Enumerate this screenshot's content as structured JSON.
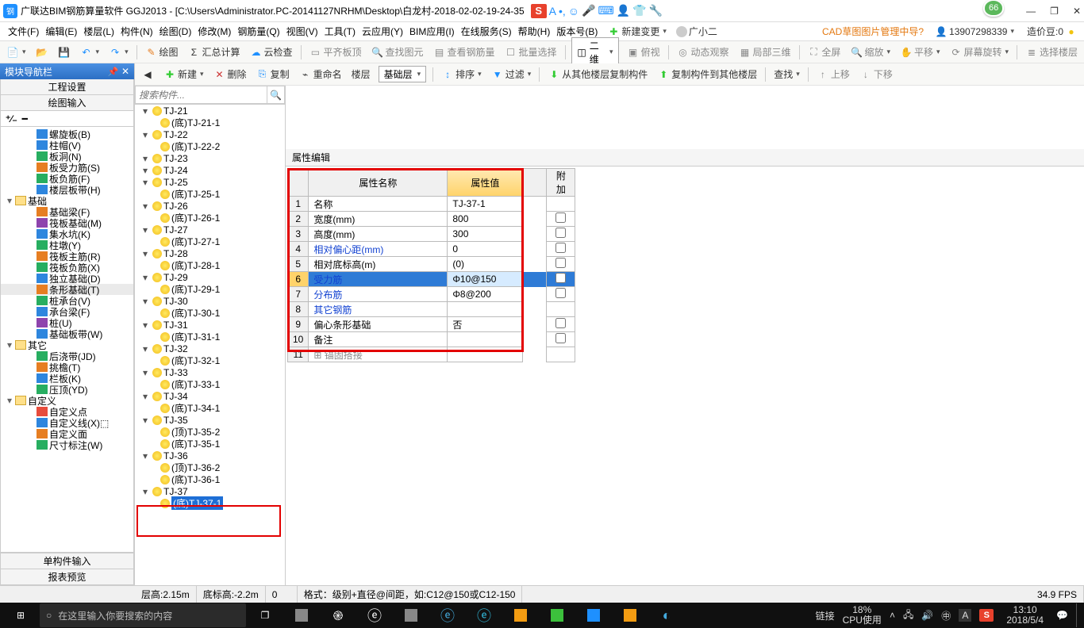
{
  "title": "广联达BIM钢筋算量软件 GGJ2013 - [C:\\Users\\Administrator.PC-20141127NRHM\\Desktop\\白龙村-2018-02-02-19-24-35",
  "ime_letter": "S",
  "badge": "66",
  "window_buttons": {
    "min": "—",
    "max": "❐",
    "close": "✕"
  },
  "menus": [
    "文件(F)",
    "编辑(E)",
    "楼层(L)",
    "构件(N)",
    "绘图(D)",
    "修改(M)",
    "钢筋量(Q)",
    "视图(V)",
    "工具(T)",
    "云应用(Y)",
    "BIM应用(I)",
    "在线服务(S)",
    "帮助(H)",
    "版本号(B)"
  ],
  "menu_extra": {
    "new_change": "新建变更",
    "user": "广小二",
    "cad_link": "CAD草图图片管理中导?",
    "phone": "13907298339",
    "price": "造价豆:0"
  },
  "tb1": {
    "draw": "绘图",
    "sum": "汇总计算",
    "cloud": "云检查",
    "flat": "平齐板顶",
    "find": "查找图元",
    "view_steel": "查看钢筋量",
    "batch": "批量选择",
    "dim": "二维",
    "over": "俯视",
    "anim": "动态观察",
    "local3d": "局部三维",
    "full": "全屏",
    "zoom": "缩放",
    "pan": "平移",
    "rot": "屏幕旋转",
    "sel_floor": "选择楼层"
  },
  "tb2": {
    "new": "新建",
    "del": "删除",
    "copy": "复制",
    "rename": "重命名",
    "floor": "楼层",
    "basic": "基础层",
    "sort": "排序",
    "filter": "过滤",
    "copy_from": "从其他楼层复制构件",
    "copy_to": "复制构件到其他楼层",
    "search": "查找",
    "up": "上移",
    "down": "下移"
  },
  "left": {
    "title": "模块导航栏",
    "s1": "工程设置",
    "s2": "绘图输入",
    "single": "单构件输入",
    "report": "报表预览",
    "tree": [
      {
        "d": 3,
        "ic": "#2e86de",
        "t": "螺旋板(B)"
      },
      {
        "d": 3,
        "ic": "#2e86de",
        "t": "柱帽(V)"
      },
      {
        "d": 3,
        "ic": "#27ae60",
        "t": "板洞(N)"
      },
      {
        "d": 3,
        "ic": "#e67e22",
        "t": "板受力筋(S)"
      },
      {
        "d": 3,
        "ic": "#27ae60",
        "t": "板负筋(F)"
      },
      {
        "d": 3,
        "ic": "#2e86de",
        "t": "楼层板带(H)"
      },
      {
        "d": 1,
        "exp": "▾",
        "fold": true,
        "t": "基础"
      },
      {
        "d": 3,
        "ic": "#e67e22",
        "t": "基础梁(F)"
      },
      {
        "d": 3,
        "ic": "#8e44ad",
        "t": "筏板基础(M)"
      },
      {
        "d": 3,
        "ic": "#2e86de",
        "t": "集水坑(K)"
      },
      {
        "d": 3,
        "ic": "#27ae60",
        "t": "柱墩(Y)"
      },
      {
        "d": 3,
        "ic": "#e67e22",
        "t": "筏板主筋(R)"
      },
      {
        "d": 3,
        "ic": "#27ae60",
        "t": "筏板负筋(X)"
      },
      {
        "d": 3,
        "ic": "#2e86de",
        "t": "独立基础(D)"
      },
      {
        "d": 3,
        "ic": "#e67e22",
        "t": "条形基础(T)",
        "sel": true
      },
      {
        "d": 3,
        "ic": "#27ae60",
        "t": "桩承台(V)"
      },
      {
        "d": 3,
        "ic": "#2e86de",
        "t": "承台梁(F)"
      },
      {
        "d": 3,
        "ic": "#8e44ad",
        "t": "桩(U)"
      },
      {
        "d": 3,
        "ic": "#2e86de",
        "t": "基础板带(W)"
      },
      {
        "d": 1,
        "exp": "▾",
        "fold": true,
        "t": "其它"
      },
      {
        "d": 3,
        "ic": "#27ae60",
        "t": "后浇带(JD)"
      },
      {
        "d": 3,
        "ic": "#e67e22",
        "t": "挑檐(T)"
      },
      {
        "d": 3,
        "ic": "#2e86de",
        "t": "栏板(K)"
      },
      {
        "d": 3,
        "ic": "#27ae60",
        "t": "压顶(YD)"
      },
      {
        "d": 1,
        "exp": "▾",
        "fold": true,
        "t": "自定义"
      },
      {
        "d": 3,
        "ic": "#e74c3c",
        "t": "自定义点"
      },
      {
        "d": 3,
        "ic": "#2e86de",
        "t": "自定义线(X)⬚"
      },
      {
        "d": 3,
        "ic": "#e67e22",
        "t": "自定义面"
      },
      {
        "d": 3,
        "ic": "#27ae60",
        "t": "尺寸标注(W)"
      }
    ]
  },
  "mid": {
    "search_ph": "搜索构件...",
    "tree": [
      {
        "p": 1,
        "t": "TJ-21"
      },
      {
        "p": 0,
        "t": "(底)TJ-21-1"
      },
      {
        "p": 1,
        "t": "TJ-22"
      },
      {
        "p": 0,
        "t": "(底)TJ-22-2"
      },
      {
        "p": 1,
        "t": "TJ-23"
      },
      {
        "p": 1,
        "t": "TJ-24"
      },
      {
        "p": 1,
        "t": "TJ-25"
      },
      {
        "p": 0,
        "t": "(底)TJ-25-1"
      },
      {
        "p": 1,
        "t": "TJ-26"
      },
      {
        "p": 0,
        "t": "(底)TJ-26-1"
      },
      {
        "p": 1,
        "t": "TJ-27"
      },
      {
        "p": 0,
        "t": "(底)TJ-27-1"
      },
      {
        "p": 1,
        "t": "TJ-28"
      },
      {
        "p": 0,
        "t": "(底)TJ-28-1"
      },
      {
        "p": 1,
        "t": "TJ-29"
      },
      {
        "p": 0,
        "t": "(底)TJ-29-1"
      },
      {
        "p": 1,
        "t": "TJ-30"
      },
      {
        "p": 0,
        "t": "(底)TJ-30-1"
      },
      {
        "p": 1,
        "t": "TJ-31"
      },
      {
        "p": 0,
        "t": "(底)TJ-31-1"
      },
      {
        "p": 1,
        "t": "TJ-32"
      },
      {
        "p": 0,
        "t": "(底)TJ-32-1"
      },
      {
        "p": 1,
        "t": "TJ-33"
      },
      {
        "p": 0,
        "t": "(底)TJ-33-1"
      },
      {
        "p": 1,
        "t": "TJ-34"
      },
      {
        "p": 0,
        "t": "(底)TJ-34-1"
      },
      {
        "p": 1,
        "t": "TJ-35"
      },
      {
        "p": 0,
        "t": "(顶)TJ-35-2"
      },
      {
        "p": 0,
        "t": "(底)TJ-35-1"
      },
      {
        "p": 1,
        "t": "TJ-36"
      },
      {
        "p": 0,
        "t": "(顶)TJ-36-2"
      },
      {
        "p": 0,
        "t": "(底)TJ-36-1"
      },
      {
        "p": 1,
        "t": "TJ-37"
      },
      {
        "p": 0,
        "t": "(底)TJ-37-1",
        "sel": true
      }
    ]
  },
  "prop": {
    "title": "属性编辑",
    "head": {
      "name": "属性名称",
      "val": "属性值",
      "add": "附加"
    },
    "rows": [
      {
        "i": "1",
        "n": "名称",
        "v": "TJ-37-1",
        "ck": false,
        "link": false
      },
      {
        "i": "2",
        "n": "宽度(mm)",
        "v": "800",
        "ck": true,
        "link": false
      },
      {
        "i": "3",
        "n": "高度(mm)",
        "v": "300",
        "ck": true,
        "link": false
      },
      {
        "i": "4",
        "n": "相对偏心距(mm)",
        "v": "0",
        "ck": true,
        "link": true
      },
      {
        "i": "5",
        "n": "相对底标高(m)",
        "v": "(0)",
        "ck": true,
        "link": false
      },
      {
        "i": "6",
        "n": "受力筋",
        "v": "Φ10@150",
        "ck": true,
        "link": true,
        "sel": true
      },
      {
        "i": "7",
        "n": "分布筋",
        "v": "Φ8@200",
        "ck": true,
        "link": true
      },
      {
        "i": "8",
        "n": "其它钢筋",
        "v": "",
        "ck": false,
        "link": true
      },
      {
        "i": "9",
        "n": "偏心条形基础",
        "v": "否",
        "ck": true,
        "link": false
      },
      {
        "i": "10",
        "n": "备注",
        "v": "",
        "ck": true,
        "link": false
      },
      {
        "i": "11",
        "n": "锚固搭接",
        "v": "",
        "ck": false,
        "link": false,
        "exp": true,
        "gray": true
      }
    ]
  },
  "status": {
    "floor_h": "层高:2.15m",
    "bot": "底标高:-2.2m",
    "zero": "0",
    "format": "格式：级别+直径@间距，如:C12@150或C12-150",
    "fps": "34.9 FPS"
  },
  "taskbar": {
    "search": "在这里输入你要搜索的内容",
    "link": "链接",
    "cpu1": "18%",
    "cpu2": "CPU使用",
    "time": "13:10",
    "date": "2018/5/4"
  }
}
